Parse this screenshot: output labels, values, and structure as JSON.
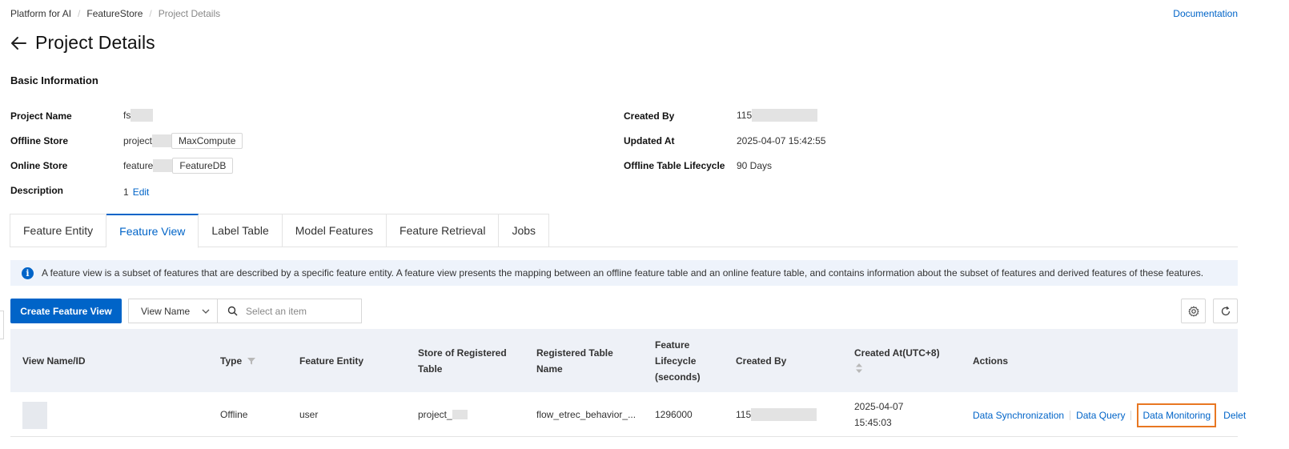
{
  "breadcrumb": {
    "items": [
      "Platform for AI",
      "FeatureStore",
      "Project Details"
    ],
    "separator": "/"
  },
  "header": {
    "title": "Project Details",
    "documentation_link": "Documentation"
  },
  "basic_info": {
    "section_title": "Basic Information",
    "left": {
      "project_name_label": "Project Name",
      "project_name_value": "fs",
      "offline_store_label": "Offline Store",
      "offline_store_value": "project",
      "offline_store_tag": "MaxCompute",
      "online_store_label": "Online Store",
      "online_store_value": "feature",
      "online_store_tag": "FeatureDB",
      "description_label": "Description",
      "description_value": "1",
      "edit_link": "Edit"
    },
    "right": {
      "created_by_label": "Created By",
      "created_by_value": "115",
      "updated_at_label": "Updated At",
      "updated_at_value": "2025-04-07 15:42:55",
      "lifecycle_label": "Offline Table Lifecycle",
      "lifecycle_value": "90 Days"
    }
  },
  "tabs": [
    {
      "label": "Feature Entity",
      "active": false
    },
    {
      "label": "Feature View",
      "active": true
    },
    {
      "label": "Label Table",
      "active": false
    },
    {
      "label": "Model Features",
      "active": false
    },
    {
      "label": "Feature Retrieval",
      "active": false
    },
    {
      "label": "Jobs",
      "active": false
    }
  ],
  "alert": {
    "text": "A feature view is a subset of features that are described by a specific feature entity. A feature view presents the mapping between an offline feature table and an online feature table, and contains information about the subset of features and derived features of these features."
  },
  "toolbar": {
    "create_button": "Create Feature View",
    "filter_select_value": "View Name",
    "search_placeholder": "Select an item"
  },
  "table": {
    "columns": {
      "name": "View Name/ID",
      "type": "Type",
      "entity": "Feature Entity",
      "store_line1": "Store of Registered",
      "store_line2": "Table",
      "table_name_line1": "Registered Table",
      "table_name_line2": "Name",
      "lifecycle_line1": "Feature",
      "lifecycle_line2": "Lifecycle",
      "lifecycle_line3": "(seconds)",
      "created_by": "Created By",
      "created_at": "Created At(UTC+8)",
      "actions": "Actions"
    },
    "rows": [
      {
        "type": "Offline",
        "entity": "user",
        "store": "project_",
        "table_name": "flow_etrec_behavior_...",
        "lifecycle": "1296000",
        "created_by": "115",
        "created_date": "2025-04-07",
        "created_time": "15:45:03",
        "actions": [
          "Data Synchronization",
          "Data Query",
          "Data Monitoring",
          "Delet"
        ]
      }
    ]
  },
  "colors": {
    "accent": "#0064c8",
    "highlight_border": "#e87722",
    "alert_bg": "#eef3fb",
    "table_head_bg": "#eef1f7"
  }
}
